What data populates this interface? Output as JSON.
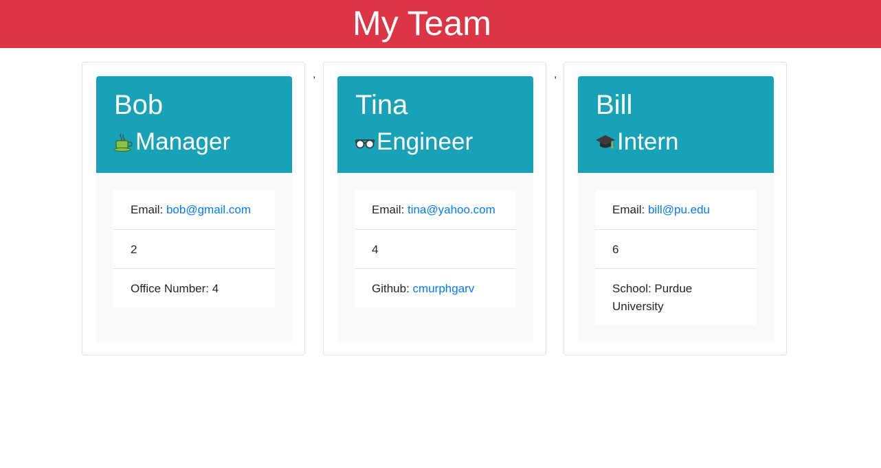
{
  "header": {
    "title": "My Team"
  },
  "separator": ",",
  "colors": {
    "header_bg": "#dc3545",
    "card_head_bg": "#17a2b8",
    "link": "#007bff"
  },
  "team": [
    {
      "name": "Bob",
      "role": "Manager",
      "role_icon": "coffee-cup-icon",
      "email_label": "Email: ",
      "email": "bob@gmail.com",
      "id": "2",
      "extra_label": "Office Number: 4",
      "extra_link": ""
    },
    {
      "name": "Tina",
      "role": "Engineer",
      "role_icon": "glasses-icon",
      "email_label": "Email: ",
      "email": "tina@yahoo.com",
      "id": "4",
      "extra_label": "Github: ",
      "extra_link": "cmurphgarv"
    },
    {
      "name": "Bill",
      "role": "Intern",
      "role_icon": "graduation-cap-icon",
      "email_label": "Email: ",
      "email": "bill@pu.edu",
      "id": "6",
      "extra_label": "School: Purdue University",
      "extra_link": ""
    }
  ]
}
